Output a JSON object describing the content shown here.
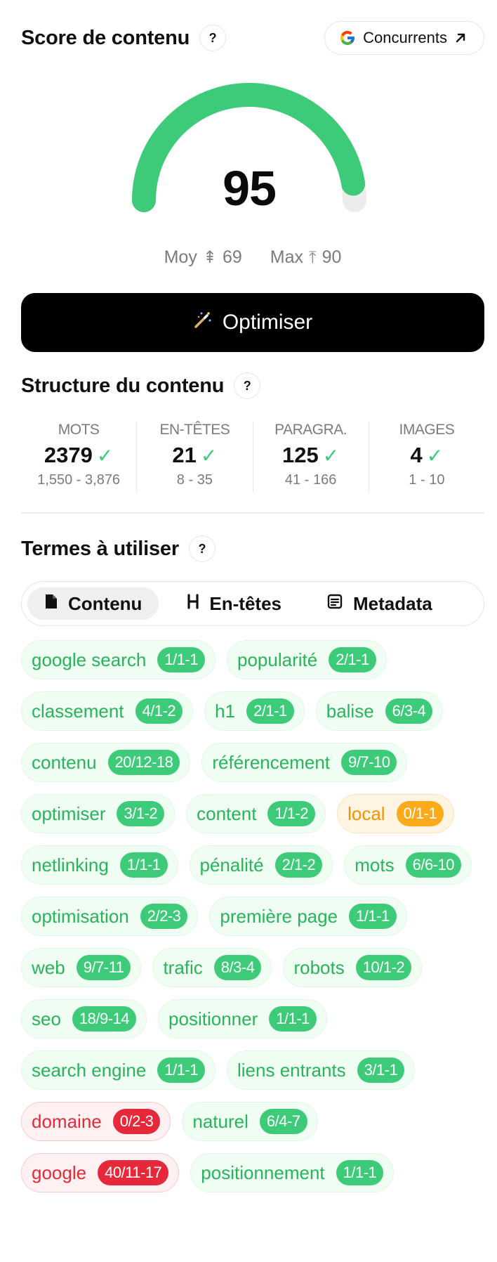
{
  "header": {
    "title": "Score de contenu",
    "help": "?",
    "competitors_label": "Concurrents"
  },
  "gauge": {
    "score": "95",
    "score_fraction": 0.95,
    "color": "#3dcb7a",
    "avg_label": "Moy",
    "avg_value": "69",
    "max_label": "Max",
    "max_value": "90"
  },
  "optimize": {
    "label": "Optimiser"
  },
  "structure": {
    "title": "Structure du contenu",
    "stats": [
      {
        "label": "MOTS",
        "value": "2379",
        "range": "1,550 - 3,876"
      },
      {
        "label": "EN-TÊTES",
        "value": "21",
        "range": "8 - 35"
      },
      {
        "label": "PARAGRA.",
        "value": "125",
        "range": "41 - 166"
      },
      {
        "label": "IMAGES",
        "value": "4",
        "range": "1 - 10"
      }
    ]
  },
  "terms": {
    "title": "Termes à utiliser",
    "tabs": [
      {
        "label": "Contenu",
        "icon": "document-icon",
        "active": true
      },
      {
        "label": "En-têtes",
        "icon": "heading-icon",
        "active": false
      },
      {
        "label": "Metadata",
        "icon": "metadata-icon",
        "active": false
      }
    ],
    "chips": [
      {
        "term": "google search",
        "count": "1/1-1",
        "status": "ok"
      },
      {
        "term": "popularité",
        "count": "2/1-1",
        "status": "ok"
      },
      {
        "term": "classement",
        "count": "4/1-2",
        "status": "ok"
      },
      {
        "term": "h1",
        "count": "2/1-1",
        "status": "ok"
      },
      {
        "term": "balise",
        "count": "6/3-4",
        "status": "ok"
      },
      {
        "term": "contenu",
        "count": "20/12-18",
        "status": "ok"
      },
      {
        "term": "référencement",
        "count": "9/7-10",
        "status": "ok"
      },
      {
        "term": "optimiser",
        "count": "3/1-2",
        "status": "ok"
      },
      {
        "term": "content",
        "count": "1/1-2",
        "status": "ok"
      },
      {
        "term": "local",
        "count": "0/1-1",
        "status": "warn"
      },
      {
        "term": "netlinking",
        "count": "1/1-1",
        "status": "ok"
      },
      {
        "term": "pénalité",
        "count": "2/1-2",
        "status": "ok"
      },
      {
        "term": "mots",
        "count": "6/6-10",
        "status": "ok"
      },
      {
        "term": "optimisation",
        "count": "2/2-3",
        "status": "ok"
      },
      {
        "term": "première page",
        "count": "1/1-1",
        "status": "ok"
      },
      {
        "term": "web",
        "count": "9/7-11",
        "status": "ok"
      },
      {
        "term": "trafic",
        "count": "8/3-4",
        "status": "ok"
      },
      {
        "term": "robots",
        "count": "10/1-2",
        "status": "ok"
      },
      {
        "term": "seo",
        "count": "18/9-14",
        "status": "ok"
      },
      {
        "term": "positionner",
        "count": "1/1-1",
        "status": "ok"
      },
      {
        "term": "search engine",
        "count": "1/1-1",
        "status": "ok"
      },
      {
        "term": "liens entrants",
        "count": "3/1-1",
        "status": "ok"
      },
      {
        "term": "domaine",
        "count": "0/2-3",
        "status": "bad"
      },
      {
        "term": "naturel",
        "count": "6/4-7",
        "status": "ok"
      },
      {
        "term": "google",
        "count": "40/11-17",
        "status": "bad"
      },
      {
        "term": "positionnement",
        "count": "1/1-1",
        "status": "ok"
      }
    ]
  }
}
